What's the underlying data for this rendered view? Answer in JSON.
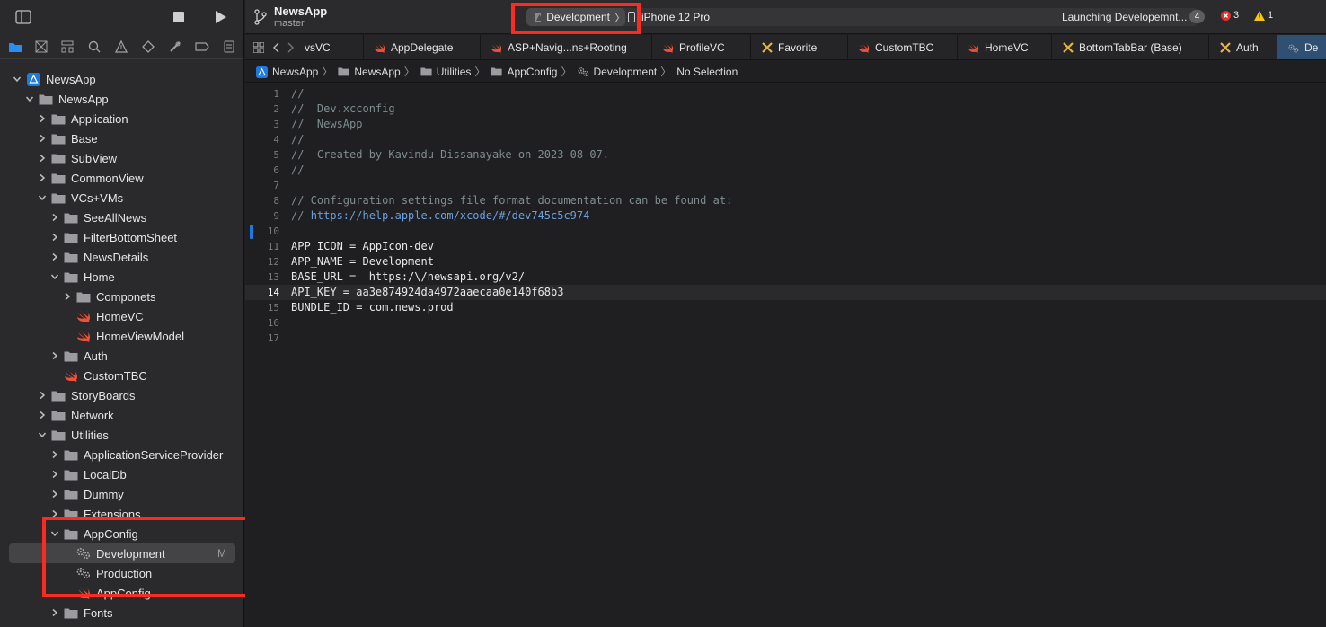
{
  "sidebar": {
    "items": [
      {
        "label": "NewsApp",
        "icon": "project-icon",
        "expanded": true
      },
      {
        "label": "NewsApp",
        "icon": "folder-icon",
        "expanded": true
      },
      {
        "label": "Application",
        "icon": "folder-icon",
        "expanded": false
      },
      {
        "label": "Base",
        "icon": "folder-icon",
        "expanded": false
      },
      {
        "label": "SubView",
        "icon": "folder-icon",
        "expanded": false
      },
      {
        "label": "CommonView",
        "icon": "folder-icon",
        "expanded": false
      },
      {
        "label": "VCs+VMs",
        "icon": "folder-icon",
        "expanded": true
      },
      {
        "label": "SeeAllNews",
        "icon": "folder-icon",
        "expanded": false
      },
      {
        "label": "FilterBottomSheet",
        "icon": "folder-icon",
        "expanded": false
      },
      {
        "label": "NewsDetails",
        "icon": "folder-icon",
        "expanded": false
      },
      {
        "label": "Home",
        "icon": "folder-icon",
        "expanded": true
      },
      {
        "label": "Componets",
        "icon": "folder-icon",
        "expanded": false
      },
      {
        "label": "HomeVC",
        "icon": "swift-icon"
      },
      {
        "label": "HomeViewModel",
        "icon": "swift-icon"
      },
      {
        "label": "Auth",
        "icon": "folder-icon",
        "expanded": false
      },
      {
        "label": "CustomTBC",
        "icon": "swift-icon"
      },
      {
        "label": "StoryBoards",
        "icon": "folder-icon",
        "expanded": false
      },
      {
        "label": "Network",
        "icon": "folder-icon",
        "expanded": false
      },
      {
        "label": "Utilities",
        "icon": "folder-icon",
        "expanded": true
      },
      {
        "label": "ApplicationServiceProvider",
        "icon": "folder-icon",
        "expanded": false
      },
      {
        "label": "LocalDb",
        "icon": "folder-icon",
        "expanded": false
      },
      {
        "label": "Dummy",
        "icon": "folder-icon",
        "expanded": false
      },
      {
        "label": "Extensions",
        "icon": "folder-icon",
        "expanded": false
      },
      {
        "label": "AppConfig",
        "icon": "folder-icon",
        "expanded": true
      },
      {
        "label": "Development",
        "icon": "config-icon",
        "badge": "M",
        "selected": true
      },
      {
        "label": "Production",
        "icon": "config-icon"
      },
      {
        "label": "AppConfig",
        "icon": "swift-icon"
      },
      {
        "label": "Fonts",
        "icon": "folder-icon",
        "expanded": false
      }
    ]
  },
  "toolbar": {
    "project_name": "NewsApp",
    "branch": "master",
    "scheme": "Development",
    "device": "iPhone 12 Pro",
    "status": "Launching Developemnt...",
    "status_count": "4",
    "errors": "3",
    "warnings": "1"
  },
  "tabs": [
    {
      "label": "vsVC",
      "icon": "swift-icon"
    },
    {
      "label": "AppDelegate",
      "icon": "swift-icon"
    },
    {
      "label": "ASP+Navig...ns+Rooting",
      "icon": "swift-icon"
    },
    {
      "label": "ProfileVC",
      "icon": "swift-icon"
    },
    {
      "label": "Favorite",
      "icon": "xib-icon"
    },
    {
      "label": "CustomTBC",
      "icon": "swift-icon"
    },
    {
      "label": "HomeVC",
      "icon": "swift-icon"
    },
    {
      "label": "BottomTabBar (Base)",
      "icon": "xib-icon"
    },
    {
      "label": "Auth",
      "icon": "xib-icon"
    },
    {
      "label": "De",
      "icon": "config-icon"
    }
  ],
  "breadcrumb": [
    {
      "label": "NewsApp",
      "icon": "project-icon"
    },
    {
      "label": "NewsApp",
      "icon": "folder-icon"
    },
    {
      "label": "Utilities",
      "icon": "folder-icon"
    },
    {
      "label": "AppConfig",
      "icon": "folder-icon"
    },
    {
      "label": "Development",
      "icon": "config-icon"
    },
    {
      "label": "No Selection",
      "icon": ""
    }
  ],
  "editor": {
    "current_line": 14,
    "lines": [
      {
        "n": "1",
        "text": "//",
        "kind": "comment"
      },
      {
        "n": "2",
        "text": "//  Dev.xcconfig",
        "kind": "comment"
      },
      {
        "n": "3",
        "text": "//  NewsApp",
        "kind": "comment"
      },
      {
        "n": "4",
        "text": "//",
        "kind": "comment"
      },
      {
        "n": "5",
        "text": "//  Created by Kavindu Dissanayake on 2023-08-07.",
        "kind": "comment"
      },
      {
        "n": "6",
        "text": "//",
        "kind": "comment"
      },
      {
        "n": "7",
        "text": "",
        "kind": "plain"
      },
      {
        "n": "8",
        "text": "// Configuration settings file format documentation can be found at:",
        "kind": "comment"
      },
      {
        "n": "9",
        "text": "// ",
        "link": "https://help.apple.com/xcode/#/dev745c5c974",
        "kind": "comment"
      },
      {
        "n": "10",
        "text": "",
        "kind": "plain"
      },
      {
        "n": "11",
        "text": "APP_ICON = AppIcon-dev",
        "kind": "plain"
      },
      {
        "n": "12",
        "text": "APP_NAME = Development",
        "kind": "plain"
      },
      {
        "n": "13",
        "text": "BASE_URL =  https:/\\/newsapi.org/v2/",
        "kind": "plain"
      },
      {
        "n": "14",
        "text": "API_KEY = aa3e874924da4972aaecaa0e140f68b3",
        "kind": "plain"
      },
      {
        "n": "15",
        "text": "BUNDLE_ID = com.news.prod",
        "kind": "plain"
      },
      {
        "n": "16",
        "text": "",
        "kind": "plain"
      },
      {
        "n": "17",
        "text": "",
        "kind": "plain"
      }
    ]
  },
  "colors": {
    "accent": "#1f7ae0",
    "highlight": "#ff2a1f",
    "swift": "#f05138",
    "xib": "#e8b53a",
    "error": "#e0332c",
    "warning": "#f5c518"
  }
}
